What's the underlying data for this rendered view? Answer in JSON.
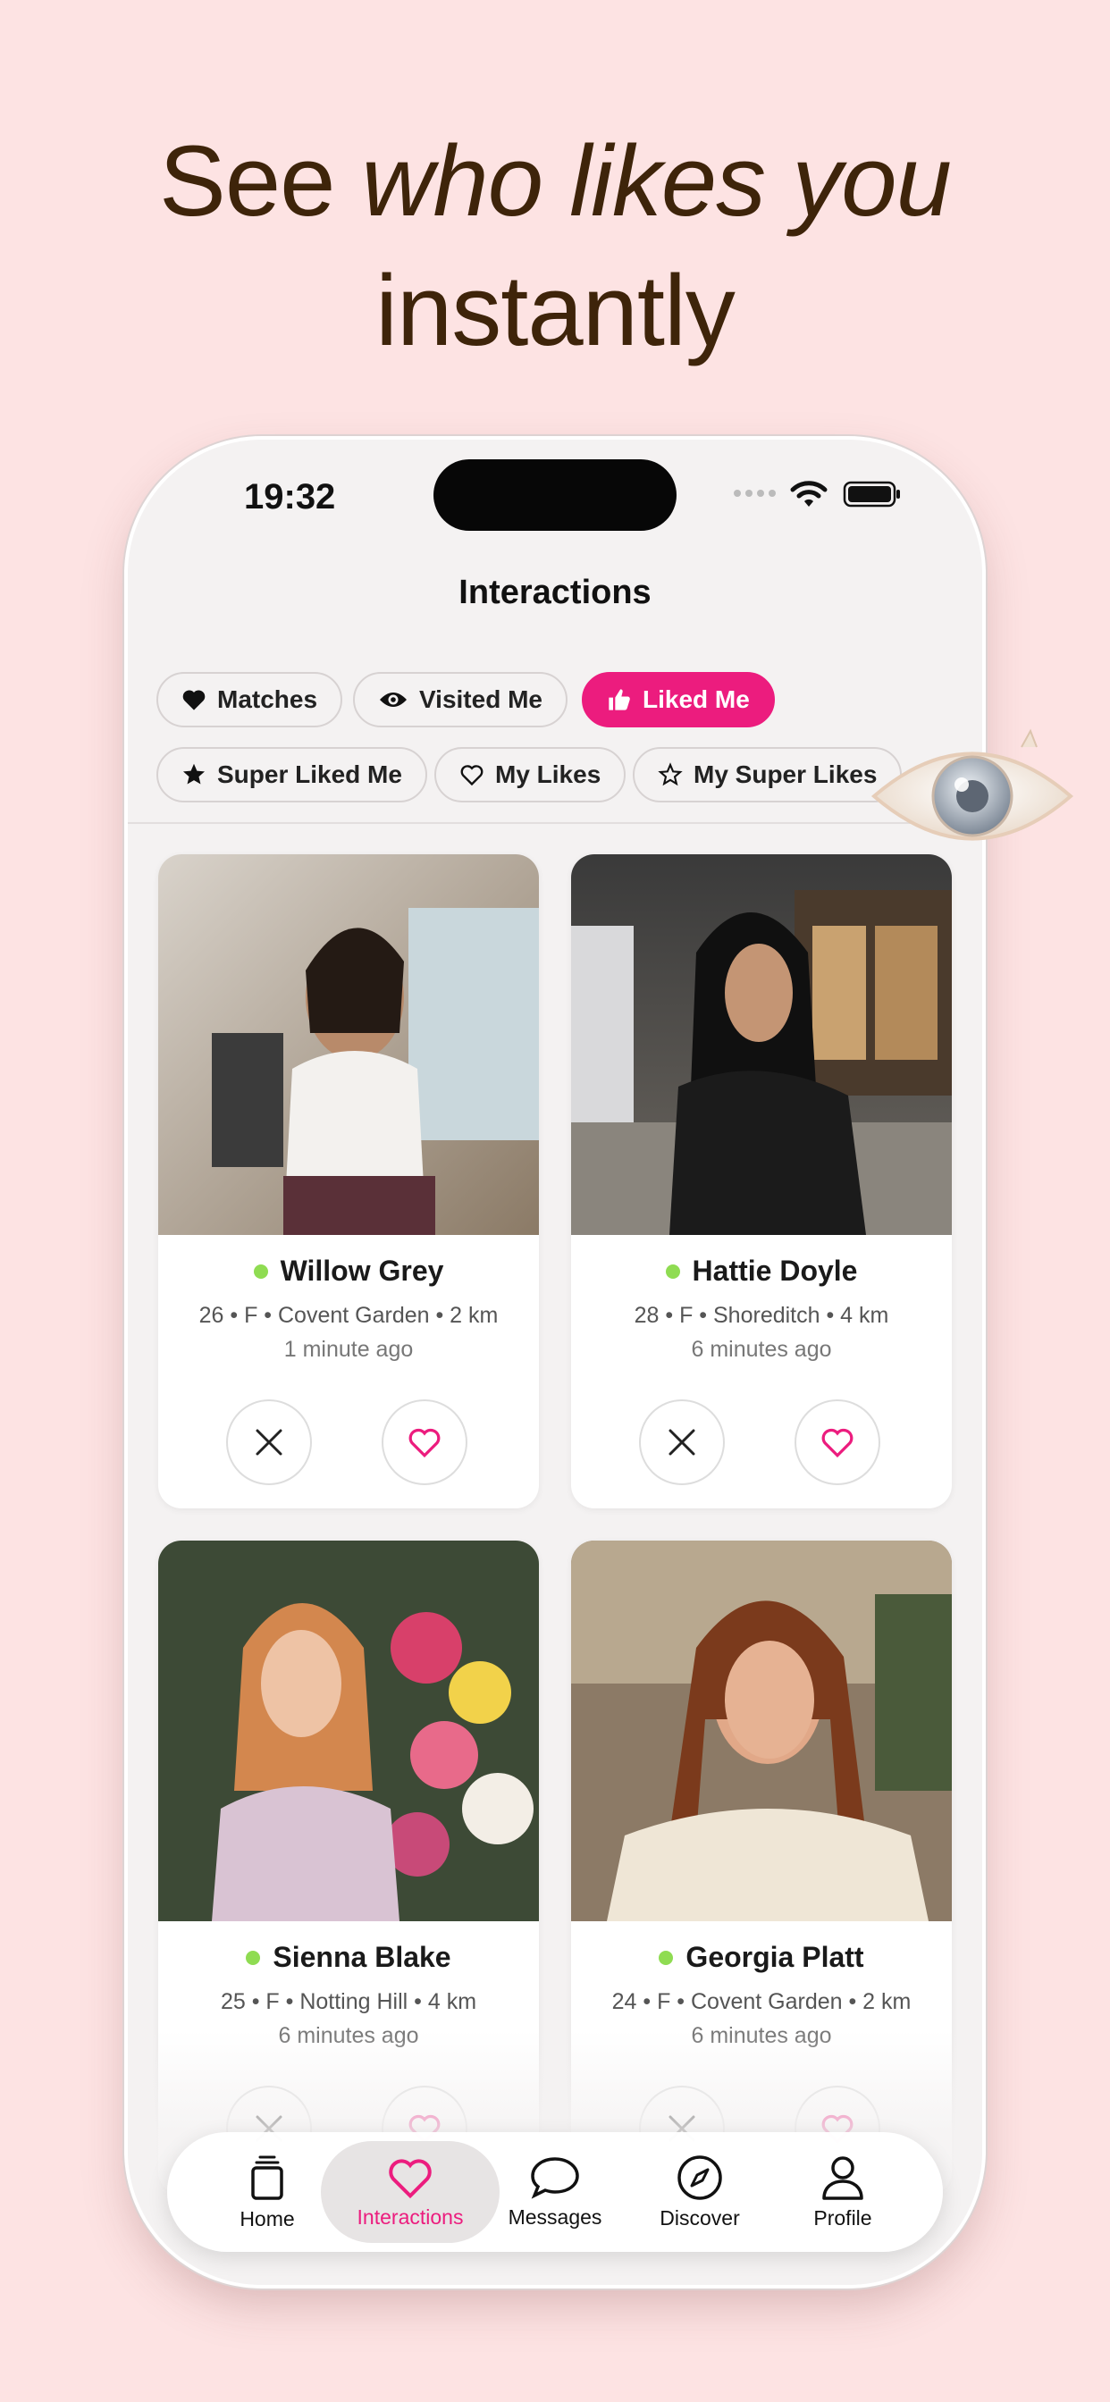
{
  "headline": {
    "line1_plain": "See ",
    "line1_italic": "who likes you",
    "line2": "instantly"
  },
  "status_bar": {
    "time": "19:32"
  },
  "screen": {
    "title": "Interactions"
  },
  "filters": [
    {
      "label": "Matches",
      "icon": "heart-filled-icon",
      "active": false
    },
    {
      "label": "Visited Me",
      "icon": "eye-icon",
      "active": false
    },
    {
      "label": "Liked Me",
      "icon": "thumbs-up-icon",
      "active": true
    },
    {
      "label": "Super Liked Me",
      "icon": "star-filled-icon",
      "active": false
    },
    {
      "label": "My Likes",
      "icon": "heart-outline-icon",
      "active": false
    },
    {
      "label": "My Super Likes",
      "icon": "star-outline-icon",
      "active": false
    }
  ],
  "profiles": [
    {
      "name": "Willow Grey",
      "meta": "26 • F • Covent Garden • 2 km",
      "time": "1 minute ago",
      "online": true
    },
    {
      "name": "Hattie Doyle",
      "meta": "28 • F • Shoreditch • 4 km",
      "time": "6 minutes ago",
      "online": true
    },
    {
      "name": "Sienna Blake",
      "meta": "25 • F • Notting Hill • 4 km",
      "time": "6 minutes ago",
      "online": true
    },
    {
      "name": "Georgia Platt",
      "meta": "24 • F • Covent Garden • 2 km",
      "time": "6 minutes ago",
      "online": true
    }
  ],
  "tabbar": [
    {
      "label": "Home",
      "icon": "home-stack-icon",
      "active": false
    },
    {
      "label": "Interactions",
      "icon": "heart-outline-icon",
      "active": true
    },
    {
      "label": "Messages",
      "icon": "chat-bubble-icon",
      "active": false
    },
    {
      "label": "Discover",
      "icon": "compass-icon",
      "active": false
    },
    {
      "label": "Profile",
      "icon": "person-icon",
      "active": false
    }
  ],
  "colors": {
    "accent": "#ec1c7e",
    "background": "#fde3e3",
    "headline": "#3e240a",
    "online": "#8fdc52"
  }
}
